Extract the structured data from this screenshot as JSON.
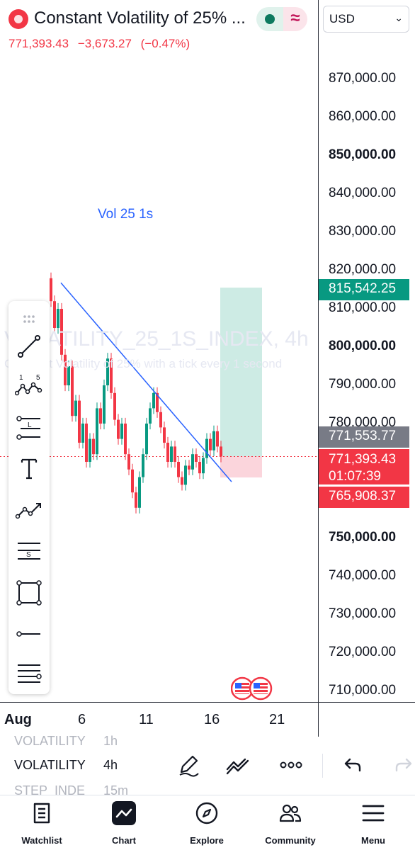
{
  "header": {
    "title": "Constant Volatility of 25% ...",
    "last_price": "771,393.43",
    "change": "−3,673.27",
    "change_pct": "(−0.47%)",
    "chart_type_glyph": "≈",
    "logo_icon": "volatility-logo-icon"
  },
  "currency": {
    "value": "USD"
  },
  "price_axis": {
    "labels": [
      {
        "text": "870,000.00",
        "bold": false
      },
      {
        "text": "860,000.00",
        "bold": false
      },
      {
        "text": "850,000.00",
        "bold": true
      },
      {
        "text": "840,000.00",
        "bold": false
      },
      {
        "text": "830,000.00",
        "bold": false
      },
      {
        "text": "820,000.00",
        "bold": false
      },
      {
        "text": "810,000.00",
        "bold": false
      },
      {
        "text": "800,000.00",
        "bold": true
      },
      {
        "text": "790,000.00",
        "bold": false
      },
      {
        "text": "780,000.00",
        "bold": false
      },
      {
        "text": "750,000.00",
        "bold": true
      },
      {
        "text": "740,000.00",
        "bold": false
      },
      {
        "text": "730,000.00",
        "bold": false
      },
      {
        "text": "720,000.00",
        "bold": false
      },
      {
        "text": "710,000.00",
        "bold": false
      }
    ],
    "tags": {
      "take_profit": "815,542.25",
      "crosshair": "771,553.77",
      "last": "771,393.43",
      "countdown": "01:07:39",
      "stop_loss": "765,908.37"
    }
  },
  "chart": {
    "study_label": "Vol 25 1s",
    "watermark_symbol": "VOLATILITY_25_1S_INDEX, 4h",
    "watermark_desc": "Constant Volatility of 25% with a tick every 1 second",
    "colors": {
      "up": "#089981",
      "down": "#f23645",
      "trendline": "#2962ff",
      "profit_zone": "#cdebe4",
      "loss_zone": "#fbd5dc"
    }
  },
  "time_axis": {
    "labels": [
      {
        "text": "Aug",
        "bold": true
      },
      {
        "text": "6",
        "bold": false
      },
      {
        "text": "11",
        "bold": false
      },
      {
        "text": "16",
        "bold": false
      },
      {
        "text": "21",
        "bold": false
      }
    ]
  },
  "symbols": [
    {
      "name": "VOLATILITY",
      "interval": "1h",
      "faded": true
    },
    {
      "name": "VOLATILITY",
      "interval": "4h",
      "faded": false
    },
    {
      "name": "STEP_INDE",
      "interval": "15m",
      "faded": true
    }
  ],
  "bottom_nav": [
    {
      "label": "Watchlist",
      "icon": "watchlist-icon"
    },
    {
      "label": "Chart",
      "icon": "chart-icon"
    },
    {
      "label": "Explore",
      "icon": "compass-icon"
    },
    {
      "label": "Community",
      "icon": "community-icon"
    },
    {
      "label": "Menu",
      "icon": "menu-icon"
    }
  ]
}
